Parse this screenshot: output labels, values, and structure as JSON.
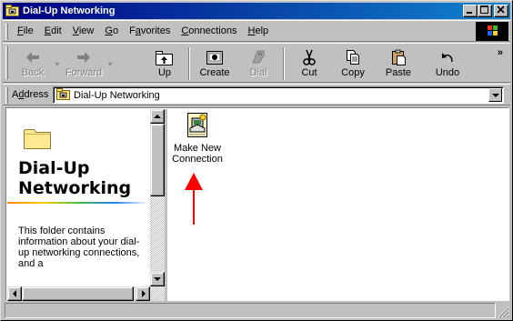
{
  "window": {
    "title": "Dial-Up Networking"
  },
  "menubar": {
    "items": [
      {
        "accel": "F",
        "rest": "ile"
      },
      {
        "accel": "E",
        "rest": "dit"
      },
      {
        "accel": "V",
        "rest": "iew"
      },
      {
        "accel": "G",
        "rest": "o"
      },
      {
        "prefix": "F",
        "accel": "a",
        "rest": "vorites"
      },
      {
        "accel": "C",
        "rest": "onnections"
      },
      {
        "accel": "H",
        "rest": "elp"
      }
    ]
  },
  "toolbar": {
    "buttons": [
      {
        "label": "Back",
        "icon": "back-arrow-icon",
        "enabled": false
      },
      {
        "label": "Forward",
        "icon": "forward-arrow-icon",
        "enabled": false
      },
      {
        "label": "Up",
        "icon": "up-folder-icon",
        "enabled": true
      },
      {
        "label": "Create",
        "icon": "create-icon",
        "enabled": true
      },
      {
        "label": "Dial",
        "icon": "dial-phone-icon",
        "enabled": false
      },
      {
        "label": "Cut",
        "icon": "scissors-icon",
        "enabled": true
      },
      {
        "label": "Copy",
        "icon": "copy-icon",
        "enabled": true
      },
      {
        "label": "Paste",
        "icon": "paste-icon",
        "enabled": true
      },
      {
        "label": "Undo",
        "icon": "undo-icon",
        "enabled": true
      }
    ],
    "more_glyph": "»"
  },
  "address": {
    "label_accel": "d",
    "label_prefix": "A",
    "label_rest": "dress",
    "value": "Dial-Up Networking"
  },
  "left_pane": {
    "title_line1": "Dial-Up",
    "title_line2": "Networking",
    "description": "This folder contains information about your dial-up networking connections, and a"
  },
  "files": [
    {
      "label_line1": "Make New",
      "label_line2": "Connection",
      "icon": "make-new-connection-icon"
    }
  ],
  "annotation": {
    "type": "red-arrow-pointing-up",
    "color": "#ff0000"
  },
  "colors": {
    "titlebar_start": "#000080",
    "titlebar_end": "#1084d0",
    "face": "#c0c0c0",
    "accent_arrow": "#ff0000"
  },
  "statusbar": {
    "text": ""
  }
}
